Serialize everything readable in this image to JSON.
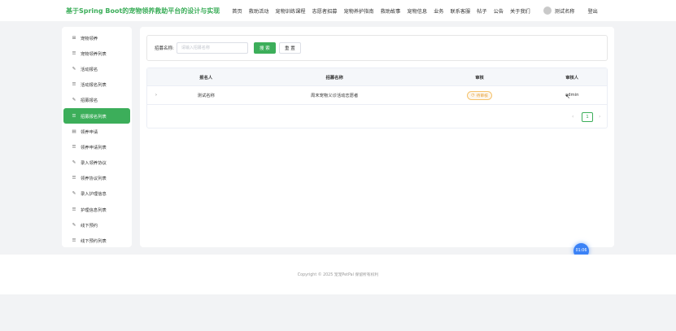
{
  "header": {
    "brand": "基于Spring Boot的宠物领养救助平台的设计与实现",
    "nav": [
      "首页",
      "救助活动",
      "宠物训练课程",
      "志愿者招募",
      "宠物养护指南",
      "救助故事",
      "宠物信息",
      "业务",
      "联系客服",
      "帖子",
      "公告",
      "关于我们"
    ],
    "user_name": "测试名称",
    "logout": "登出"
  },
  "sidebar": {
    "items": [
      {
        "label": "宠物领养",
        "icon": "clipboard-icon"
      },
      {
        "label": "宠物领养列表",
        "icon": "list-icon"
      },
      {
        "label": "活动报名",
        "icon": "edit-icon"
      },
      {
        "label": "活动报名列表",
        "icon": "list-icon"
      },
      {
        "label": "招募报名",
        "icon": "edit-icon"
      },
      {
        "label": "招募报名列表",
        "icon": "list-icon",
        "active": true
      },
      {
        "label": "领养申请",
        "icon": "document-icon"
      },
      {
        "label": "领养申请列表",
        "icon": "list-icon"
      },
      {
        "label": "录入领养协议",
        "icon": "edit-icon"
      },
      {
        "label": "领养协议列表",
        "icon": "list-icon"
      },
      {
        "label": "录入护理信息",
        "icon": "edit-icon"
      },
      {
        "label": "护理信息列表",
        "icon": "list-icon"
      },
      {
        "label": "线下预约",
        "icon": "edit-icon"
      },
      {
        "label": "线下预约列表",
        "icon": "list-icon"
      }
    ]
  },
  "search": {
    "label": "招募名称:",
    "placeholder": "请输入招募名称",
    "search_button": "搜 索",
    "reset_button": "重 置"
  },
  "table": {
    "columns": [
      "报名人",
      "招募名称",
      "审核",
      "审核人"
    ],
    "rows": [
      {
        "expand": "›",
        "name": "测试名称",
        "recruit": "周末宠物义诊活动志愿者",
        "status": "待审核",
        "reviewer": "admin"
      }
    ]
  },
  "pagination": {
    "prev": "‹",
    "current": "1",
    "next": "›"
  },
  "float_clock": "01:06",
  "footer": {
    "copyright": "Copyright © 2025 宠宠PetPal 保留所有权利"
  },
  "colors": {
    "accent": "#3cae5a",
    "pending": "#e6a23c",
    "float": "#3b82f6"
  }
}
